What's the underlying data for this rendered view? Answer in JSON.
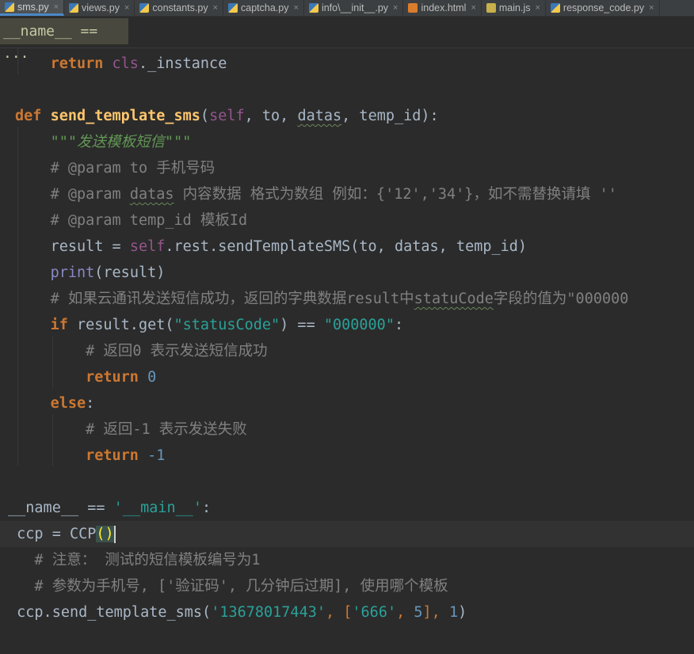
{
  "tabs": [
    {
      "label": "sms.py",
      "type": "py",
      "active": true
    },
    {
      "label": "views.py",
      "type": "py"
    },
    {
      "label": "constants.py",
      "type": "py"
    },
    {
      "label": "captcha.py",
      "type": "py"
    },
    {
      "label": "info\\__init__.py",
      "type": "py"
    },
    {
      "label": "index.html",
      "type": "html"
    },
    {
      "label": "main.js",
      "type": "js"
    },
    {
      "label": "response_code.py",
      "type": "py"
    }
  ],
  "breadcrumb": "__name__ == ···",
  "code": {
    "l1": {
      "indent": "    ",
      "kw": "return",
      "sp": " ",
      "cls": "cls",
      "rest": "._instance"
    },
    "l2": {
      "kw": "def",
      "sp": " ",
      "fn": "send_template_sms",
      "p1": "(",
      "self": "self",
      "p2": ", to, ",
      "datas": "datas",
      "p3": ", temp_id):"
    },
    "l3": {
      "indent": "    ",
      "doc": "\"\"\"发送模板短信\"\"\""
    },
    "l4": {
      "indent": "    ",
      "a": "# @param to 手机号码"
    },
    "l5": {
      "indent": "    ",
      "a": "# @param ",
      "b": "datas",
      "c": " 内容数据 格式为数组 例如：{'12','34'}，如不需替换请填 ''"
    },
    "l6": {
      "indent": "    ",
      "a": "# @param temp_id 模板Id"
    },
    "l7": {
      "indent": "    ",
      "a": "result = ",
      "self": "self",
      "b": ".rest.sendTemplateSMS(to, datas, temp_id)"
    },
    "l8": {
      "indent": "    ",
      "bi": "print",
      "b": "(result)"
    },
    "l9": {
      "indent": "    ",
      "a": "# 如果云通讯发送短信成功，返回的字典数据result中",
      "b": "statuCode",
      "c": "字段的值为\"000000"
    },
    "l10": {
      "indent": "    ",
      "kw": "if",
      "a": " result.get(",
      "s1": "\"statusCode\"",
      "b": ") == ",
      "s2": "\"000000\"",
      "c": ":"
    },
    "l11": {
      "indent": "        ",
      "a": "# 返回0 表示发送短信成功"
    },
    "l12": {
      "indent": "        ",
      "kw": "return",
      "sp": " ",
      "num": "0"
    },
    "l13": {
      "indent": "    ",
      "kw": "else",
      "a": ":"
    },
    "l14": {
      "indent": "        ",
      "a": "# 返回-1 表示发送失败"
    },
    "l15": {
      "indent": "        ",
      "kw": "return",
      "sp": " ",
      "num": "-1"
    },
    "l16": {
      "a": "__name__ == ",
      "s": "'__main__'",
      "b": ":"
    },
    "l17": {
      "indent": " ",
      "a": "ccp = CCP",
      "b": "(",
      "c": ")"
    },
    "l18": {
      "indent": "   ",
      "a": "# 注意： 测试的短信模板编号为1"
    },
    "l19": {
      "indent": "   ",
      "a": "# 参数为手机号, ['验证码', 几分钟后过期], 使用哪个模板"
    },
    "l20": {
      "indent": " ",
      "a": "ccp.send_template_sms(",
      "s1": "'13678017443'",
      "b": ", [",
      "s2": "'666'",
      "c": ", ",
      "n1": "5",
      "d": "], ",
      "n2": "1",
      "e": ")"
    }
  }
}
